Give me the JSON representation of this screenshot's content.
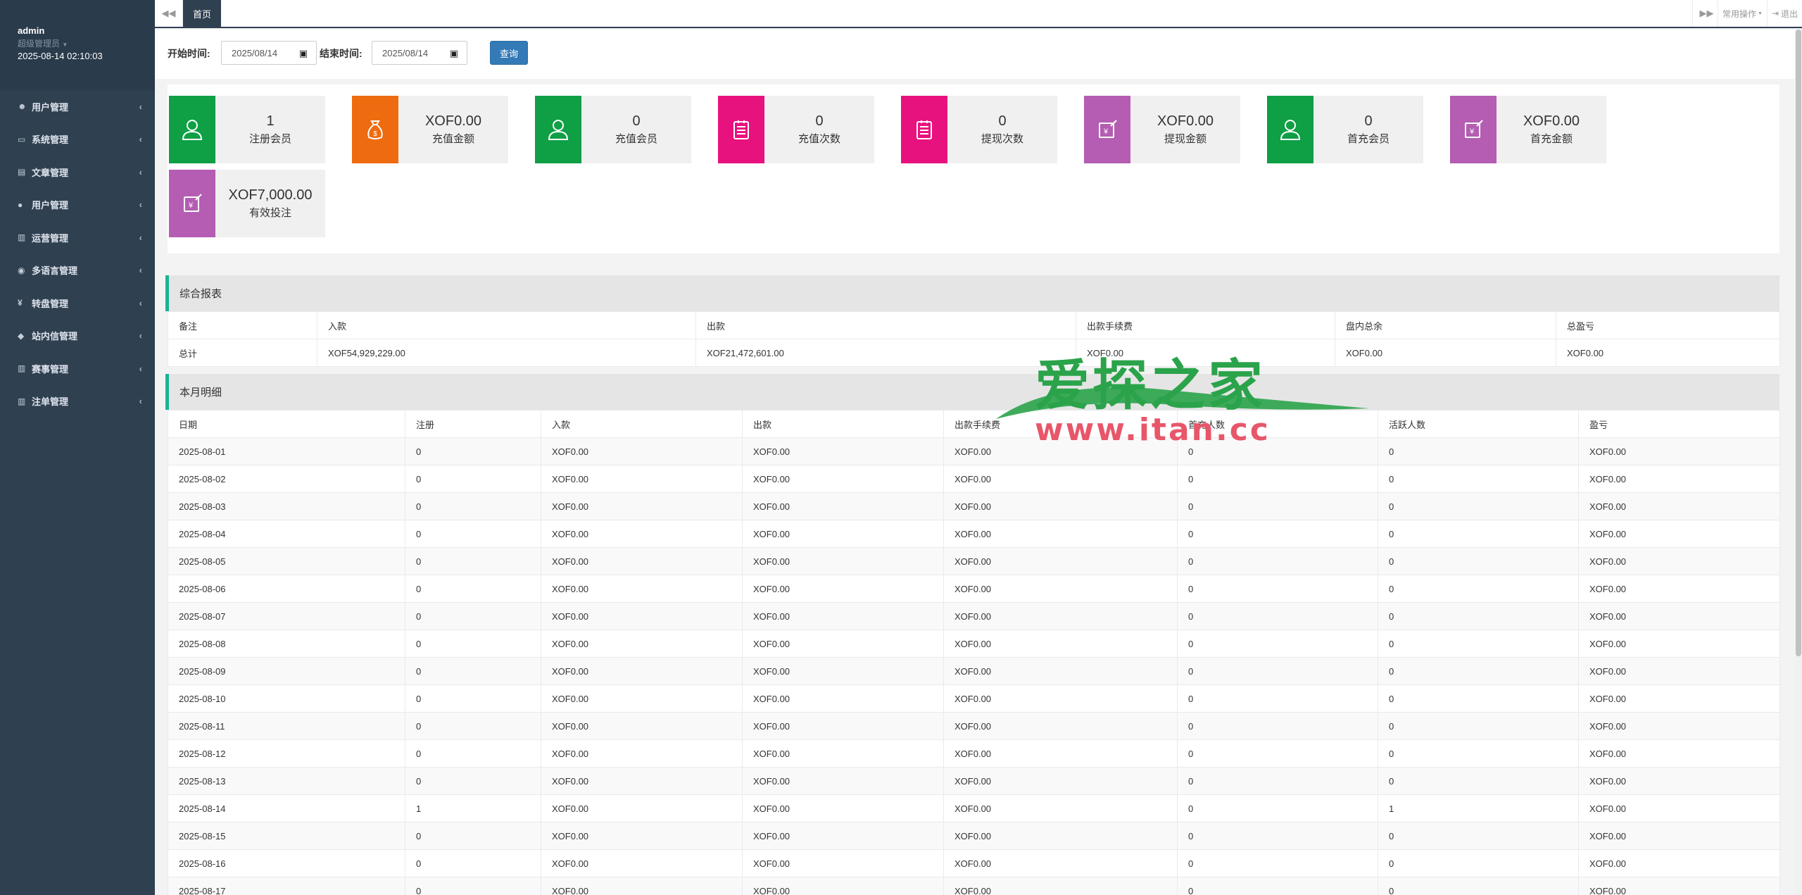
{
  "profile": {
    "username": "admin",
    "role": "超级管理员",
    "datetime": "2025-08-14 02:10:03"
  },
  "nav": [
    {
      "label": "用户管理",
      "icon": "users-icon"
    },
    {
      "label": "系统管理",
      "icon": "desktop-icon"
    },
    {
      "label": "文章管理",
      "icon": "book-icon"
    },
    {
      "label": "用户管理",
      "icon": "user-icon"
    },
    {
      "label": "运营管理",
      "icon": "bar-chart-icon"
    },
    {
      "label": "多语言管理",
      "icon": "globe-icon"
    },
    {
      "label": "转盘管理",
      "icon": "yen-icon"
    },
    {
      "label": "站内信管理",
      "icon": "comment-icon"
    },
    {
      "label": "赛事管理",
      "icon": "bar-chart-icon"
    },
    {
      "label": "注单管理",
      "icon": "bar-chart-icon"
    }
  ],
  "topbar": {
    "tab": "首页",
    "ops": "常用操作",
    "exit": "退出"
  },
  "filter": {
    "start_label": "开始时间:",
    "start_value": "2025/08/14",
    "end_label": "结束时间:",
    "end_value": "2025/08/14",
    "query": "查询"
  },
  "colors": {
    "green": "#1ab394",
    "card_green": "#0f9f45",
    "orange": "#ef6b0f",
    "pink": "#e8127f",
    "purple": "#b45db2",
    "sidebar": "#2f4050"
  },
  "stats": [
    {
      "value": "1",
      "label": "注册会员",
      "icon": "user-icon",
      "color": "#0f9f45"
    },
    {
      "value": "XOF0.00",
      "label": "充值金额",
      "icon": "money-bag-icon",
      "color": "#ef6b0f"
    },
    {
      "value": "0",
      "label": "充值会员",
      "icon": "user-icon",
      "color": "#0f9f45"
    },
    {
      "value": "0",
      "label": "充值次数",
      "icon": "clipboard-icon",
      "color": "#e8127f"
    },
    {
      "value": "0",
      "label": "提现次数",
      "icon": "clipboard-icon",
      "color": "#e8127f"
    },
    {
      "value": "XOF0.00",
      "label": "提现金额",
      "icon": "yen-edit-icon",
      "color": "#b45db2"
    },
    {
      "value": "0",
      "label": "首充会员",
      "icon": "user-icon",
      "color": "#0f9f45"
    },
    {
      "value": "XOF0.00",
      "label": "首充金额",
      "icon": "yen-edit-icon",
      "color": "#b45db2"
    },
    {
      "value": "XOF7,000.00",
      "label": "有效投注",
      "icon": "yen-edit-icon",
      "color": "#b45db2"
    }
  ],
  "summary": {
    "title": "综合报表",
    "headers": [
      "备注",
      "入款",
      "出款",
      "出款手续费",
      "盘内总余",
      "总盈亏"
    ],
    "row": [
      "总计",
      "XOF54,929,229.00",
      "XOF21,472,601.00",
      "XOF0.00",
      "XOF0.00",
      "XOF0.00"
    ]
  },
  "monthly": {
    "title": "本月明细",
    "headers": [
      "日期",
      "注册",
      "入款",
      "出款",
      "出款手续费",
      "首充人数",
      "活跃人数",
      "盈亏"
    ],
    "rows": [
      [
        "2025-08-01",
        "0",
        "XOF0.00",
        "XOF0.00",
        "XOF0.00",
        "0",
        "0",
        "XOF0.00"
      ],
      [
        "2025-08-02",
        "0",
        "XOF0.00",
        "XOF0.00",
        "XOF0.00",
        "0",
        "0",
        "XOF0.00"
      ],
      [
        "2025-08-03",
        "0",
        "XOF0.00",
        "XOF0.00",
        "XOF0.00",
        "0",
        "0",
        "XOF0.00"
      ],
      [
        "2025-08-04",
        "0",
        "XOF0.00",
        "XOF0.00",
        "XOF0.00",
        "0",
        "0",
        "XOF0.00"
      ],
      [
        "2025-08-05",
        "0",
        "XOF0.00",
        "XOF0.00",
        "XOF0.00",
        "0",
        "0",
        "XOF0.00"
      ],
      [
        "2025-08-06",
        "0",
        "XOF0.00",
        "XOF0.00",
        "XOF0.00",
        "0",
        "0",
        "XOF0.00"
      ],
      [
        "2025-08-07",
        "0",
        "XOF0.00",
        "XOF0.00",
        "XOF0.00",
        "0",
        "0",
        "XOF0.00"
      ],
      [
        "2025-08-08",
        "0",
        "XOF0.00",
        "XOF0.00",
        "XOF0.00",
        "0",
        "0",
        "XOF0.00"
      ],
      [
        "2025-08-09",
        "0",
        "XOF0.00",
        "XOF0.00",
        "XOF0.00",
        "0",
        "0",
        "XOF0.00"
      ],
      [
        "2025-08-10",
        "0",
        "XOF0.00",
        "XOF0.00",
        "XOF0.00",
        "0",
        "0",
        "XOF0.00"
      ],
      [
        "2025-08-11",
        "0",
        "XOF0.00",
        "XOF0.00",
        "XOF0.00",
        "0",
        "0",
        "XOF0.00"
      ],
      [
        "2025-08-12",
        "0",
        "XOF0.00",
        "XOF0.00",
        "XOF0.00",
        "0",
        "0",
        "XOF0.00"
      ],
      [
        "2025-08-13",
        "0",
        "XOF0.00",
        "XOF0.00",
        "XOF0.00",
        "0",
        "0",
        "XOF0.00"
      ],
      [
        "2025-08-14",
        "1",
        "XOF0.00",
        "XOF0.00",
        "XOF0.00",
        "0",
        "1",
        "XOF0.00"
      ],
      [
        "2025-08-15",
        "0",
        "XOF0.00",
        "XOF0.00",
        "XOF0.00",
        "0",
        "0",
        "XOF0.00"
      ],
      [
        "2025-08-16",
        "0",
        "XOF0.00",
        "XOF0.00",
        "XOF0.00",
        "0",
        "0",
        "XOF0.00"
      ],
      [
        "2025-08-17",
        "0",
        "XOF0.00",
        "XOF0.00",
        "XOF0.00",
        "0",
        "0",
        "XOF0.00"
      ]
    ]
  },
  "watermark": {
    "title": "爱探之家",
    "url": "www.itan.cc"
  }
}
